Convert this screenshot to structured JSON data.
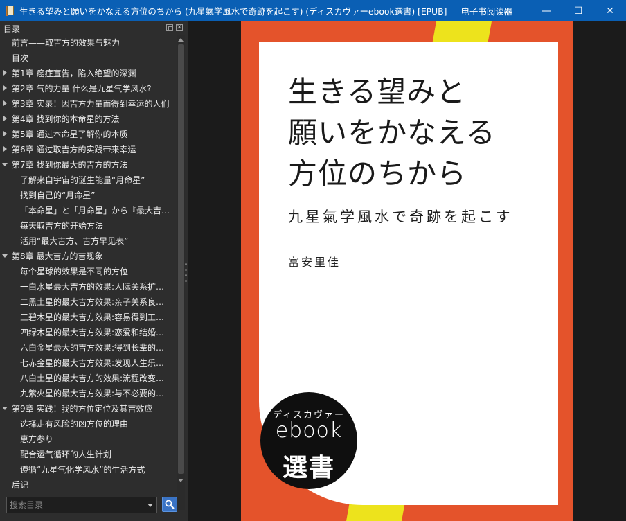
{
  "window": {
    "title": "生きる望みと願いをかなえる方位のちから (九星氣学風水で奇跡を起こす) (ディスカヴァーebook選書) [EPUB] — 电子书阅读器",
    "minimize_symbol": "—",
    "maximize_symbol": "☐",
    "close_symbol": "✕"
  },
  "toc": {
    "title": "目录",
    "close_symbol": "✕",
    "items": [
      {
        "label": "前言——取吉方的效果与魅力",
        "level": 0,
        "arrow": "none"
      },
      {
        "label": "目次",
        "level": 0,
        "arrow": "none"
      },
      {
        "label": "第1章 癌症宣告，陷入绝望的深渊",
        "level": 0,
        "arrow": "collapsed"
      },
      {
        "label": "第2章 气的力量 什么是九星气学风水?",
        "level": 0,
        "arrow": "collapsed"
      },
      {
        "label": "第3章 实录！因吉方力量而得到幸运的人们",
        "level": 0,
        "arrow": "collapsed"
      },
      {
        "label": "第4章 找到你的本命星的方法",
        "level": 0,
        "arrow": "collapsed"
      },
      {
        "label": "第5章 通过本命星了解你的本质",
        "level": 0,
        "arrow": "collapsed"
      },
      {
        "label": "第6章 通过取吉方的实践带来幸运",
        "level": 0,
        "arrow": "collapsed"
      },
      {
        "label": "第7章 找到你最大的吉方的方法",
        "level": 0,
        "arrow": "expanded"
      },
      {
        "label": "了解来自宇宙的诞生能量“月命星”",
        "level": 1,
        "arrow": "none"
      },
      {
        "label": "找到自己的“月命星”",
        "level": 1,
        "arrow": "none"
      },
      {
        "label": "「本命星」と「月命星」から『最大吉…",
        "level": 1,
        "arrow": "none"
      },
      {
        "label": "每天取吉方的开始方法",
        "level": 1,
        "arrow": "none"
      },
      {
        "label": "活用“最大吉方、吉方早见表”",
        "level": 1,
        "arrow": "none"
      },
      {
        "label": "第8章 最大吉方的吉现象",
        "level": 0,
        "arrow": "expanded"
      },
      {
        "label": "每个星球的效果是不同的方位",
        "level": 1,
        "arrow": "none"
      },
      {
        "label": "一白水星最大吉方的效果:人际关系扩大…",
        "level": 1,
        "arrow": "none"
      },
      {
        "label": "二黑土星的最大吉方效果:亲子关系良好…",
        "level": 1,
        "arrow": "none"
      },
      {
        "label": "三碧木星的最大吉方效果:容易得到工作…",
        "level": 1,
        "arrow": "none"
      },
      {
        "label": "四绿木星的最大吉方效果:恋爱和结婚运…",
        "level": 1,
        "arrow": "none"
      },
      {
        "label": "六白金星最大的吉方效果:得到长辈的支…",
        "level": 1,
        "arrow": "none"
      },
      {
        "label": "七赤金星的最大吉方效果:发现人生乐趣…",
        "level": 1,
        "arrow": "none"
      },
      {
        "label": "八白土星的最大吉方的效果:流程改变自…",
        "level": 1,
        "arrow": "none"
      },
      {
        "label": "九紫火星的最大吉方效果:与不必要的东…",
        "level": 1,
        "arrow": "none"
      },
      {
        "label": "第9章 实践！我的方位定位及其吉效应",
        "level": 0,
        "arrow": "expanded"
      },
      {
        "label": "选择走有风险的凶方位的理由",
        "level": 1,
        "arrow": "none"
      },
      {
        "label": "恵方参り",
        "level": 1,
        "arrow": "none"
      },
      {
        "label": "配合运气循环的人生计划",
        "level": 1,
        "arrow": "none"
      },
      {
        "label": "遵循“九星气化学风水”的生活方式",
        "level": 1,
        "arrow": "none"
      },
      {
        "label": "后记",
        "level": 0,
        "arrow": "none"
      }
    ]
  },
  "search": {
    "placeholder": "搜索目录",
    "icon": "search-icon"
  },
  "book": {
    "title_lines": [
      "生きる望みと",
      "願いをかなえる",
      "方位のちから"
    ],
    "subtitle": "九星氣学風水で奇跡を起こす",
    "author": "富安里佳",
    "series_kana": "ディスカヴァー",
    "series_name": "ebook",
    "series_kanji": "選書"
  },
  "colors": {
    "titlebar": "#0a5fb4",
    "sidebar": "#2d2d2d",
    "cover_orange": "#e4532b",
    "cover_yellow": "#ede31c",
    "search_button": "#3a73c4"
  }
}
